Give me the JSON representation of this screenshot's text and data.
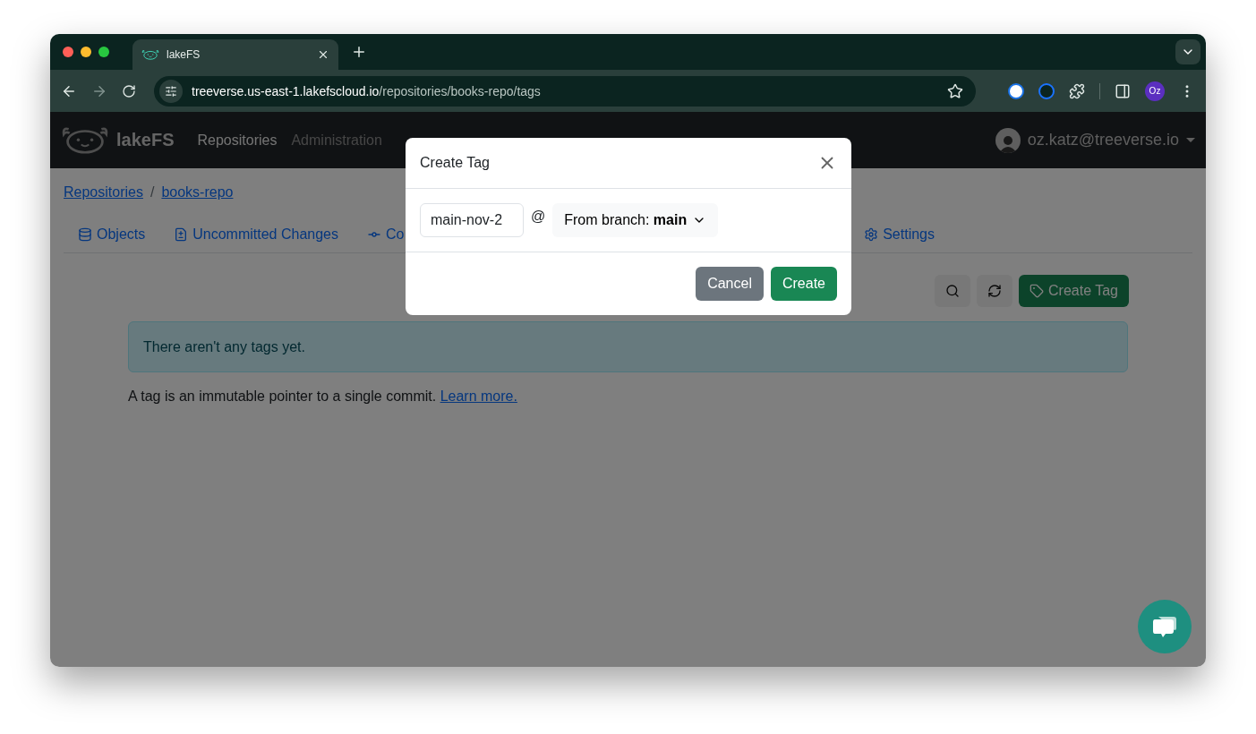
{
  "browser": {
    "tab_title": "lakeFS",
    "url_host": "treeverse.us-east-1.lakefscloud.io",
    "url_path": "/repositories/books-repo/tags",
    "profile": "Oz"
  },
  "navbar": {
    "brand": "lakeFS",
    "links": [
      {
        "label": "Repositories",
        "active": true
      },
      {
        "label": "Administration",
        "active": false
      }
    ],
    "user": "oz.katz@treeverse.io"
  },
  "breadcrumbs": {
    "separator": "/",
    "items": [
      "Repositories",
      "books-repo"
    ]
  },
  "tabs": [
    {
      "label": "Objects",
      "kind": "objects"
    },
    {
      "label": "Uncommitted Changes",
      "kind": "changes"
    },
    {
      "label": "Co",
      "kind": "commits"
    },
    {
      "label": "Settings",
      "kind": "settings"
    }
  ],
  "toolbar": {
    "create_button": "Create Tag"
  },
  "alert": "There aren't any tags yet.",
  "help": {
    "text": "A tag is an immutable pointer to a single commit.",
    "link": "Learn more."
  },
  "modal": {
    "title": "Create Tag",
    "tag_name": "main-nov-2",
    "at": "@",
    "branch_select": "From branch: **main**",
    "buttons": [
      {
        "label": "Cancel",
        "kind": "secondary"
      },
      {
        "label": "Create",
        "kind": "primary"
      }
    ]
  }
}
